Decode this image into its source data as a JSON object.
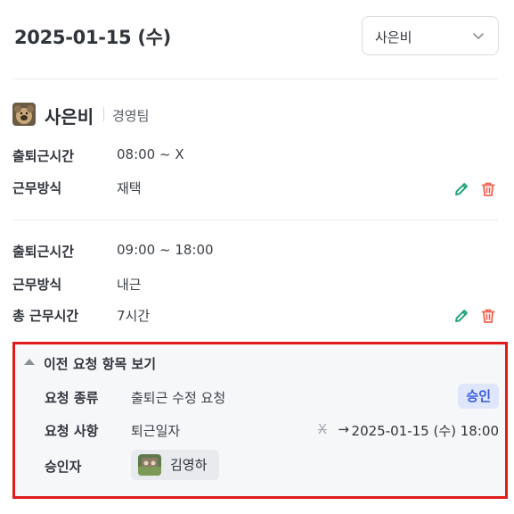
{
  "header": {
    "date_title": "2025-01-15 (수)",
    "selected_person": "사은비"
  },
  "profile": {
    "name": "사은비",
    "team": "경영팀"
  },
  "records": [
    {
      "rows": [
        {
          "label": "출퇴근시간",
          "value": "08:00 ~ X"
        },
        {
          "label": "근무방식",
          "value": "재택"
        }
      ]
    },
    {
      "rows": [
        {
          "label": "출퇴근시간",
          "value": "09:00 ~ 18:00"
        },
        {
          "label": "근무방식",
          "value": "내근"
        },
        {
          "label": "총 근무시간",
          "value": "7시간"
        }
      ]
    }
  ],
  "history": {
    "toggle_label": "이전 요청 항목 보기",
    "request_type_label": "요청 종류",
    "request_type_value": "출퇴근 수정 요청",
    "status_badge": "승인",
    "request_detail_label": "요청 사항",
    "request_detail_value": "퇴근일자",
    "old_value": "X",
    "arrow": "→",
    "new_value": "2025-01-15 (수) 18:00",
    "approver_label": "승인자",
    "approver_name": "김영하"
  },
  "colors": {
    "edit_icon": "#1aa36f",
    "delete_icon": "#f2604f",
    "badge_bg": "#dfe6fb",
    "badge_text": "#3a5bd9",
    "highlight_border": "#e01b1b"
  },
  "icons": [
    "chevron-down-icon",
    "pencil-icon",
    "trash-icon",
    "caret-up-icon"
  ]
}
